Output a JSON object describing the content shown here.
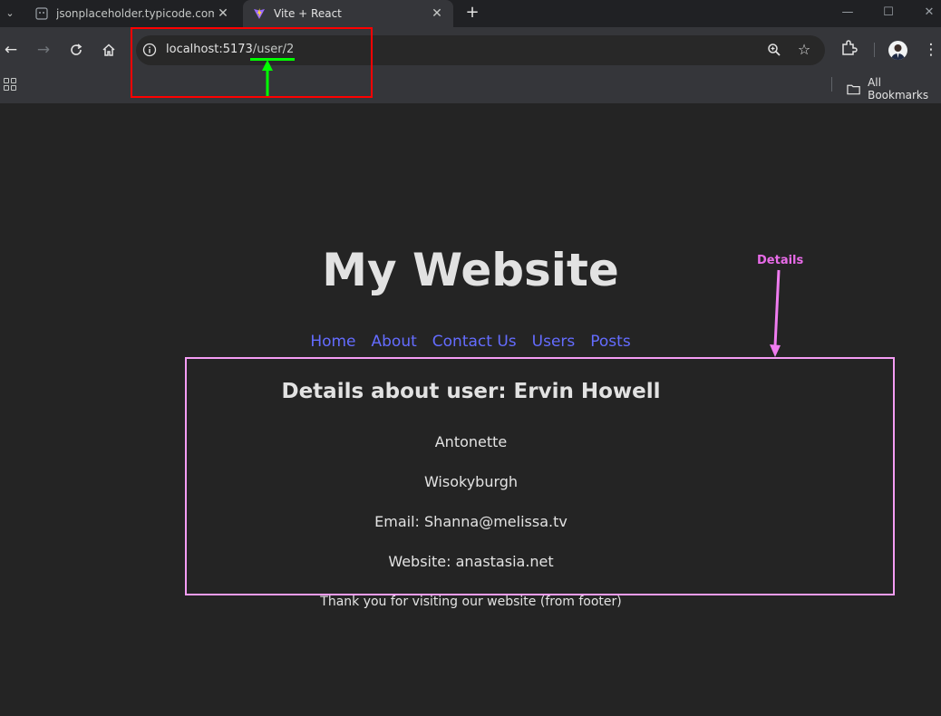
{
  "browser": {
    "tabs": [
      {
        "title": "jsonplaceholder.typicode.com/p",
        "active": false
      },
      {
        "title": "Vite + React",
        "active": true
      }
    ],
    "url_host": "localhost:5173",
    "url_path": "/user/2",
    "all_bookmarks_label": "All Bookmarks"
  },
  "page": {
    "heading": "My Website",
    "nav": [
      "Home",
      "About",
      "Contact Us",
      "Users",
      "Posts"
    ],
    "details_title": "Details about user: Ervin Howell",
    "username": "Antonette",
    "city": "Wisokyburgh",
    "email_line": "Email: Shanna@melissa.tv",
    "website_line": "Website: anastasia.net",
    "footer": "Thank you for visiting our website (from footer)"
  },
  "annotations": {
    "details_label": "Details",
    "colors": {
      "url_box": "#ff0000",
      "url_underline": "#00ff00",
      "details_box": "#f49cf4",
      "details_label": "#e86be8"
    }
  },
  "colors": {
    "page_bg": "#242424",
    "link": "#646cff",
    "chrome_bg": "#35363a",
    "tab_strip_bg": "#202124"
  },
  "icons": [
    "tab-search-icon",
    "vite-logo-icon",
    "back-arrow-icon",
    "forward-arrow-icon",
    "reload-icon",
    "home-icon",
    "site-info-icon",
    "zoom-icon",
    "star-icon",
    "extensions-icon",
    "profile-avatar",
    "menu-dots-icon",
    "apps-grid-icon",
    "folder-icon"
  ]
}
